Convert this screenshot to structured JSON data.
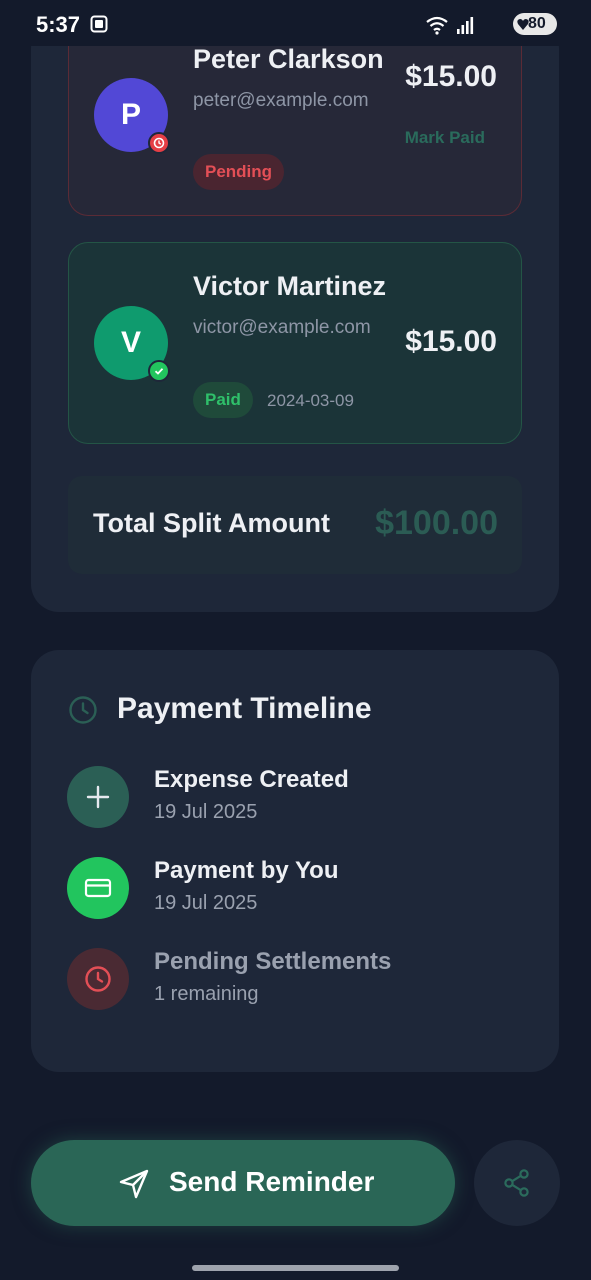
{
  "status_bar": {
    "time": "5:37",
    "battery": "80"
  },
  "members": [
    {
      "initial": "P",
      "name": "Peter Clarkson",
      "email": "peter@example.com",
      "amount": "$15.00",
      "status": "Pending",
      "action": "Mark Paid"
    },
    {
      "initial": "V",
      "name": "Victor Martinez",
      "email": "victor@example.com",
      "amount": "$15.00",
      "status": "Paid",
      "date": "2024-03-09"
    }
  ],
  "total": {
    "label": "Total Split Amount",
    "value": "$100.00"
  },
  "timeline": {
    "title": "Payment Timeline",
    "items": [
      {
        "label": "Expense Created",
        "sub": "19 Jul 2025"
      },
      {
        "label": "Payment by You",
        "sub": "19 Jul 2025"
      },
      {
        "label": "Pending Settlements",
        "sub": "1 remaining"
      }
    ]
  },
  "actions": {
    "send_reminder": "Send Reminder"
  },
  "colors": {
    "accent": "#2a6656",
    "pending": "#e34f56",
    "paid": "#22c55e",
    "background": "#131a2b",
    "card": "#1e2739"
  }
}
